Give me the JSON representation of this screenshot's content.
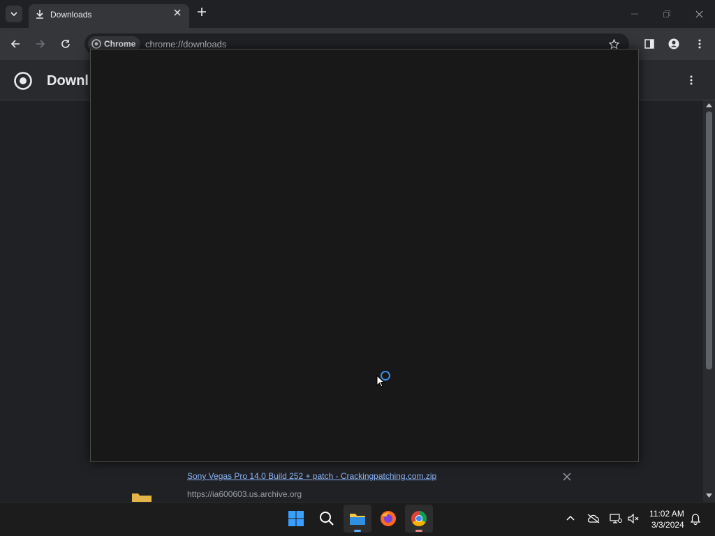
{
  "browser": {
    "tab_title": "Downloads",
    "chip_label": "Chrome",
    "url": "chrome://downloads"
  },
  "page": {
    "title_visible": "Downl"
  },
  "download": {
    "file_name": "Sony Vegas Pro 14.0 Build 252 + patch - Crackingpatching.com.zip",
    "source_url": "https://ia600603.us.archive.org"
  },
  "taskbar": {
    "time": "11:02 AM",
    "date": "3/3/2024"
  },
  "icons": [
    "tab-search-icon",
    "download-icon",
    "close-icon",
    "new-tab-icon",
    "minimize-icon",
    "maximize-icon",
    "back-icon",
    "forward-icon",
    "reload-icon",
    "chrome-icon",
    "bookmark-star-icon",
    "side-panel-icon",
    "profile-icon",
    "menu-icon",
    "kebab-icon",
    "folder-icon",
    "spinner-icon",
    "cursor-icon",
    "windows-start-icon",
    "search-icon",
    "file-explorer-icon",
    "firefox-icon",
    "chrome-icon",
    "chevron-up-icon",
    "cloud-off-icon",
    "network-icon",
    "volume-muted-icon",
    "bell-icon"
  ],
  "colors": {
    "accent": "#8ab4f8",
    "spinner": "#3a8ee6"
  }
}
